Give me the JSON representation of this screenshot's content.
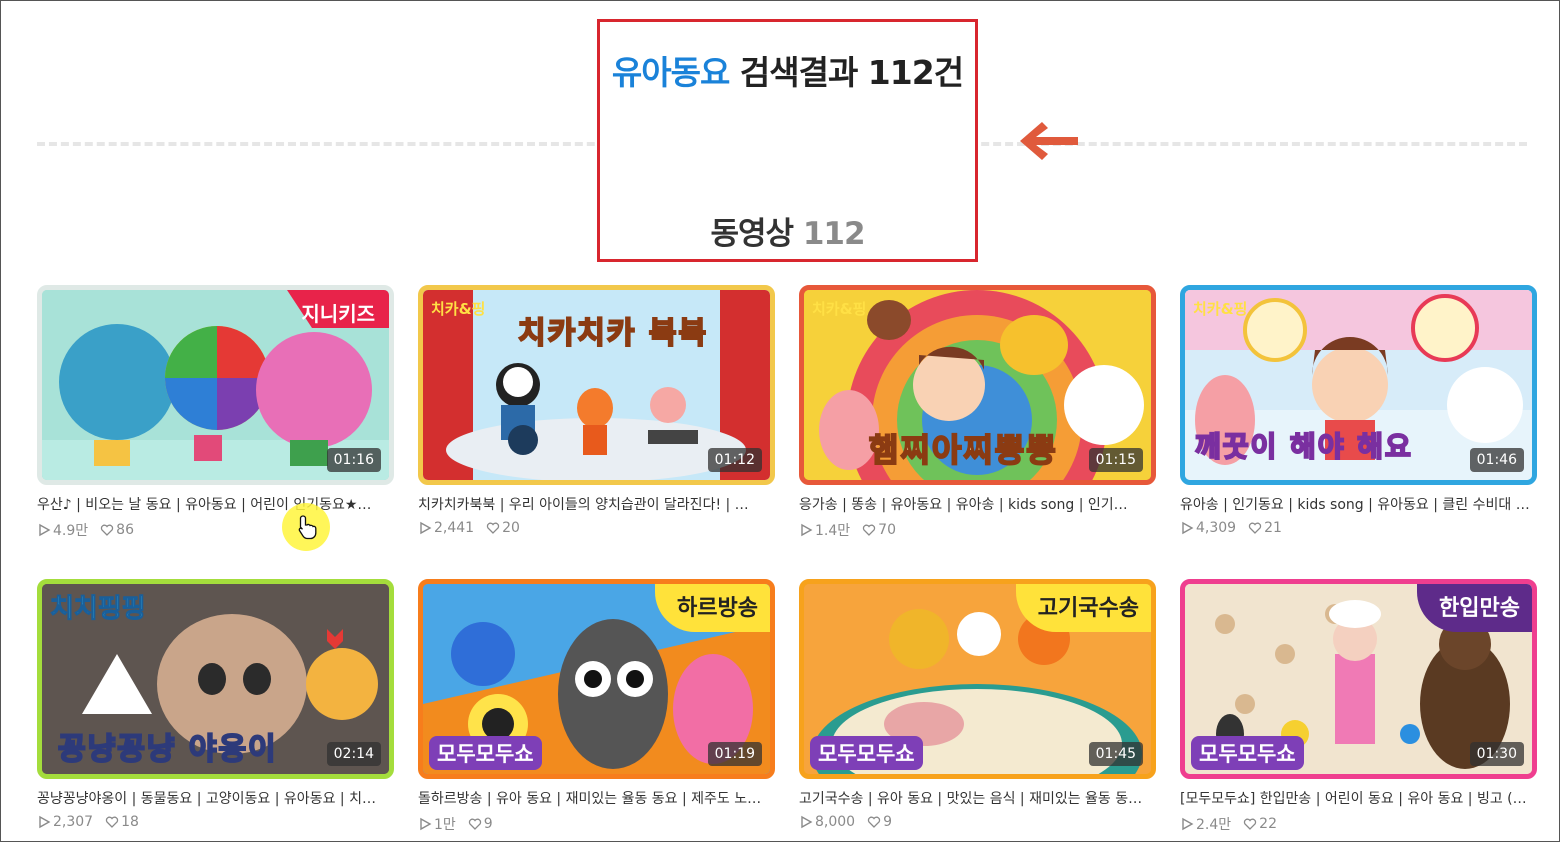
{
  "header": {
    "keyword": "유아동요",
    "result_label": "검색결과 112건",
    "video_tab_label": "동영상",
    "video_tab_count": "112"
  },
  "videos": [
    {
      "title": "우산♪ | 비오는 날 동요 | 유아동요 | 어린이 인기동요★…",
      "views": "4.9만",
      "likes": "86",
      "duration": "01:16",
      "brand": "지니키즈"
    },
    {
      "title": "치카치카북북 | 우리 아이들의 양치습관이 달라진다! | …",
      "views": "2,441",
      "likes": "20",
      "duration": "01:12",
      "brand": "치카&핑",
      "overlay": "치카치카 북북"
    },
    {
      "title": "응가송 | 똥송 | 유아동요 | 유아송 | kids song | 인기…",
      "views": "1.4만",
      "likes": "70",
      "duration": "01:15",
      "brand": "치카&핑",
      "overlay": "햄찌아찌뽕뽕"
    },
    {
      "title": "유아송 | 인기동요 | kids song | 유아동요 | 클린 수비대 …",
      "views": "4,309",
      "likes": "21",
      "duration": "01:46",
      "brand": "치카&핑",
      "overlay": "깨끗이 해야 해요"
    },
    {
      "title": "꽁냥꽁냥야옹이 | 동물동요 | 고양이동요 | 유아동요 | 치…",
      "views": "2,307",
      "likes": "18",
      "duration": "02:14",
      "brand": "치치핑핑",
      "overlay": "꽁냥꽁냥 야옹이"
    },
    {
      "title": "돌하르방송 | 유아 동요 | 재미있는 율동 동요 | 제주도 노…",
      "views": "1만",
      "likes": "9",
      "duration": "01:19",
      "tag": "하르방송",
      "show": "모두모두쇼"
    },
    {
      "title": "고기국수송 | 유아 동요 | 맛있는 음식 | 재미있는 율동 동…",
      "views": "8,000",
      "likes": "9",
      "duration": "01:45",
      "tag": "고기국수송",
      "show": "모두모두쇼"
    },
    {
      "title": "[모두모두쇼] 한입만송 | 어린이 동요 | 유아 동요 | 빙고 (…",
      "views": "2.4만",
      "likes": "22",
      "duration": "01:30",
      "tag": "한입만송",
      "show": "모두모두쇼"
    }
  ],
  "icons": {
    "play": "play-outline-icon",
    "like": "heart-outline-icon",
    "arrow": "left-arrow-icon",
    "cursor": "hand-pointer-icon"
  },
  "colors": {
    "keyword": "#1a82d9",
    "highlight_box": "#d8262e",
    "arrow": "#e05a3c"
  }
}
